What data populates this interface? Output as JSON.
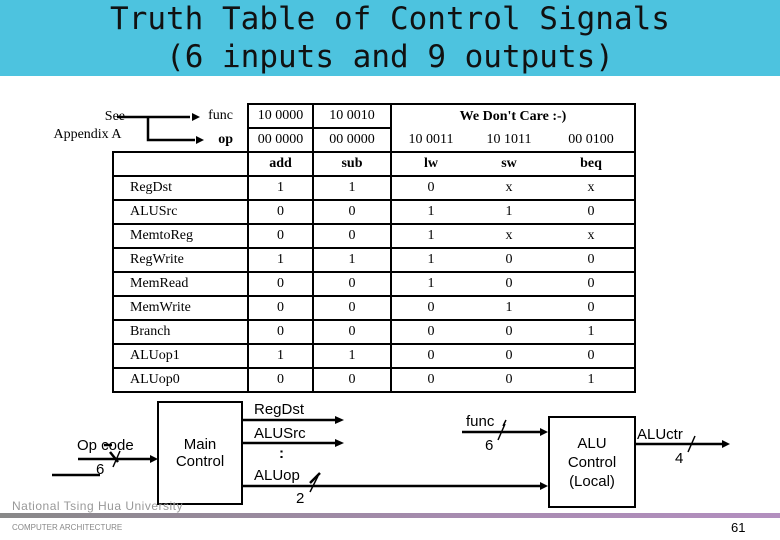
{
  "title": {
    "line1": "Truth Table of Control Signals",
    "line2": "(6 inputs and 9 outputs)",
    "bg_color": "#4dc3df"
  },
  "note": {
    "line1": "See",
    "line2": "Appendix A"
  },
  "table": {
    "func_label": "func",
    "op_label": "op",
    "func": [
      "10 0000",
      "10 0010"
    ],
    "dont_care": "We Don't Care :-)",
    "op": [
      "00 0000",
      "00 0000",
      "10 0011",
      "10 1011",
      "00 0100"
    ],
    "instr": [
      "add",
      "sub",
      "lw",
      "sw",
      "beq"
    ],
    "rows": [
      {
        "label": "RegDst",
        "v": [
          "1",
          "1",
          "0",
          "x",
          "x"
        ]
      },
      {
        "label": "ALUSrc",
        "v": [
          "0",
          "0",
          "1",
          "1",
          "0"
        ]
      },
      {
        "label": "MemtoReg",
        "v": [
          "0",
          "0",
          "1",
          "x",
          "x"
        ]
      },
      {
        "label": "RegWrite",
        "v": [
          "1",
          "1",
          "1",
          "0",
          "0"
        ]
      },
      {
        "label": "MemRead",
        "v": [
          "0",
          "0",
          "1",
          "0",
          "0"
        ]
      },
      {
        "label": "MemWrite",
        "v": [
          "0",
          "0",
          "0",
          "1",
          "0"
        ]
      },
      {
        "label": "Branch",
        "v": [
          "0",
          "0",
          "0",
          "0",
          "1"
        ]
      },
      {
        "label": "ALUop1",
        "v": [
          "1",
          "1",
          "0",
          "0",
          "0"
        ]
      },
      {
        "label": "ALUop0",
        "v": [
          "0",
          "0",
          "0",
          "0",
          "1"
        ]
      }
    ]
  },
  "diagram": {
    "opcode": "Op code",
    "opcode_width": "6",
    "main_control": [
      "Main",
      "Control"
    ],
    "outputs": [
      "RegDst",
      "ALUSrc",
      ":",
      "ALUop"
    ],
    "aluop_width": "2",
    "func": "func",
    "func_width": "6",
    "alu_control": [
      "ALU",
      "Control",
      "(Local)"
    ],
    "aluctr": "ALUctr",
    "aluctr_width": "4"
  },
  "footer": {
    "university": "National Tsing Hua University",
    "course": "COMPUTER ARCHITECTURE",
    "page": "61"
  }
}
